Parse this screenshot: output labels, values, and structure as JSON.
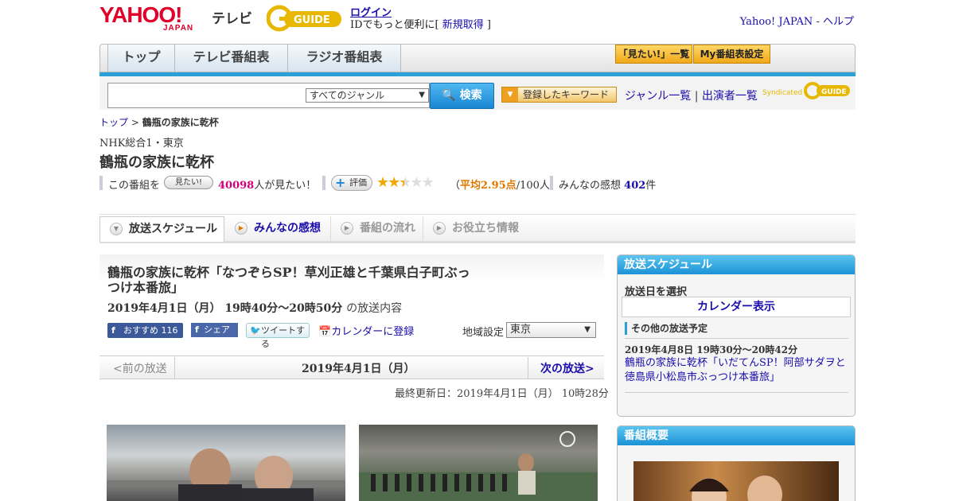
{
  "header": {
    "logo_yahoo": "YAHOO!",
    "logo_japan": "JAPAN",
    "logo_tv": "テレビ",
    "login_link": "ログイン",
    "login_sub_prefix": "IDでもっと便利に[ ",
    "register_link": "新規取得",
    "login_sub_suffix": " ]",
    "yahoo_japan_link": "Yahoo! JAPAN",
    "help_sep": " - ",
    "help_link": "ヘルプ"
  },
  "nav": {
    "tabs": [
      "トップ",
      "テレビ番組表",
      "ラジオ番組表"
    ],
    "want_list": "「見たい!」一覧",
    "my_schedule": "My番組表設定"
  },
  "search": {
    "genre_selected": "すべてのジャンル",
    "search_button": "検索",
    "keyword_button": "登録したキーワード",
    "genre_list": "ジャンル一覧",
    "performer_list": "出演者一覧",
    "syndicated": "Syndicated"
  },
  "breadcrumb": {
    "top": "トップ",
    "sep": " > ",
    "current": "鶴瓶の家族に乾杯"
  },
  "program": {
    "channel": "NHK総合1・東京",
    "title": "鶴瓶の家族に乾杯",
    "want_prefix": "この番組を",
    "want_btn": "見たい!",
    "want_count": "40098",
    "want_suffix": "人が見たい！",
    "rate_btn": "評価",
    "avg_prefix": "（",
    "avg_value": "平均2.95点",
    "avg_suffix": "/100人）",
    "impressions_label": "みんなの感想",
    "impressions_count": "402",
    "impressions_unit": "件"
  },
  "tabs": {
    "schedule": "放送スケジュール",
    "impressions": "みんなの感想",
    "flow": "番組の流れ",
    "info": "お役立ち情報"
  },
  "episode": {
    "title": "鶴瓶の家族に乾杯「なつぞらSP！草刈正雄と千葉県白子町ぶっつけ本番旅」",
    "time": "2019年4月1日（月） 19時40分～20時50分",
    "time_suffix": "の放送内容",
    "fb_recommend": "おすすめ",
    "fb_count": "116",
    "fb_share": "シェア",
    "tweet": "ツイートする",
    "calendar_register": "カレンダーに登録",
    "region_label": "地域設定",
    "region_value": "東京",
    "prev": "<前の放送",
    "date": "2019年4月1日（月）",
    "next": "次の放送>",
    "updated": "最終更新日：2019年4月1日（月） 10時28分"
  },
  "sidebar": {
    "schedule_header": "放送スケジュール",
    "select_date": "放送日を選択",
    "calendar_show": "カレンダー表示",
    "other_schedule": "その他の放送予定",
    "other_time": "2019年4月8日 19時30分～20時42分",
    "other_link": "鶴瓶の家族に乾杯「いだてんSP！阿部サダヲと徳島県小松島市ぶっつけ本番旅」",
    "summary_header": "番組概要"
  },
  "ratings": {
    "stars": 2.95,
    "max_stars": 5
  },
  "colors": {
    "accent_blue": "#2a9fd8",
    "yahoo_red": "#e0002a",
    "want_pink": "#d0007a",
    "avg_orange": "#e07800"
  }
}
